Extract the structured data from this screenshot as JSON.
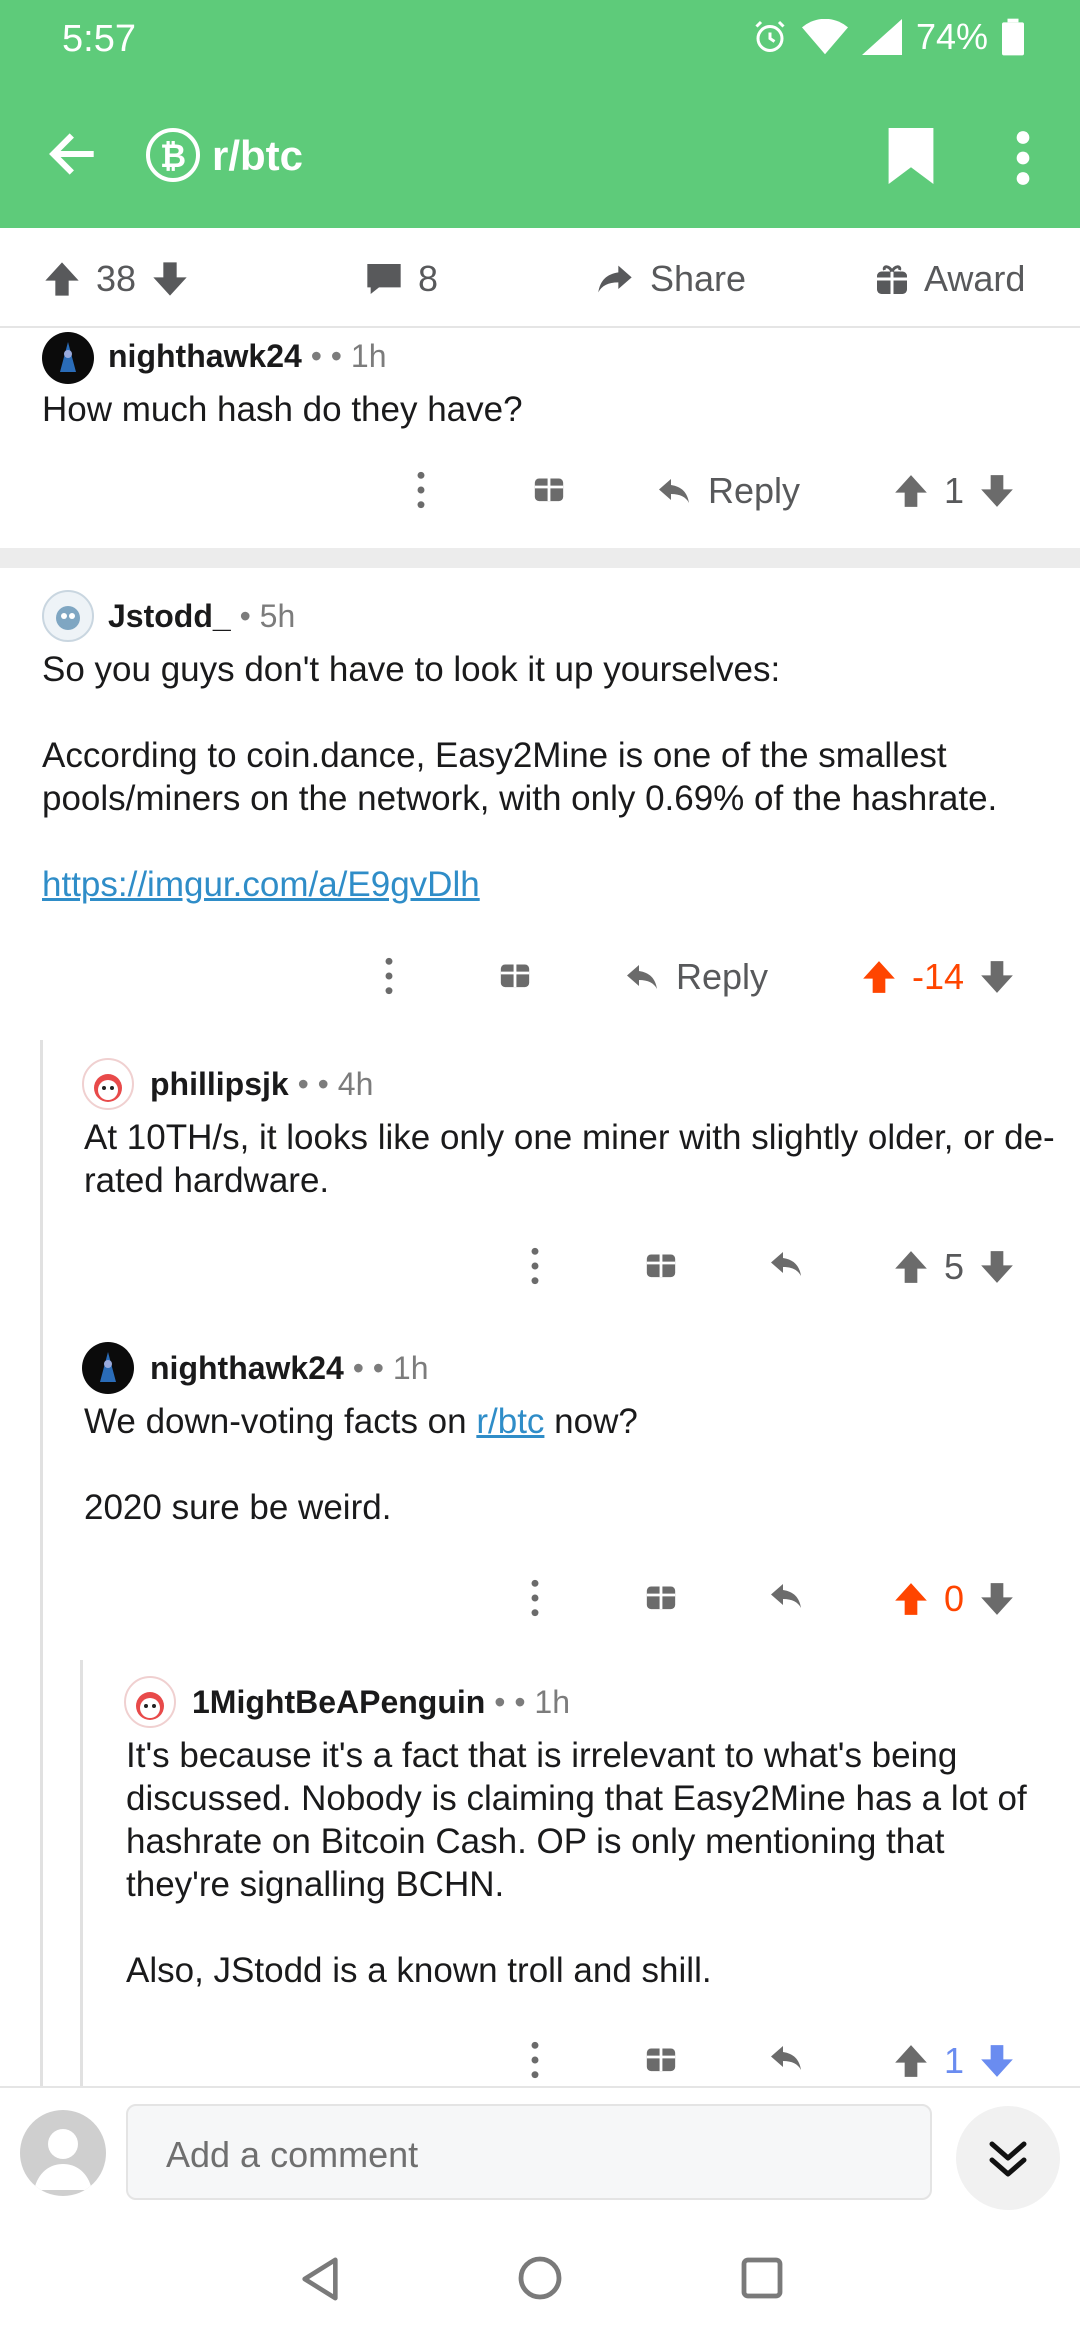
{
  "status": {
    "time": "5:57",
    "battery": "74%"
  },
  "header": {
    "subreddit": "r/btc",
    "sub_glyph": "₿"
  },
  "postbar": {
    "upvotes": "38",
    "comments": "8",
    "share_label": "Share",
    "award_label": "Award"
  },
  "comments": [
    {
      "author": "nighthawk24",
      "separator": "•",
      "age": "• 1h",
      "text": [
        "How much hash do they have?"
      ],
      "reply_label": "Reply",
      "score": "1"
    },
    {
      "author": "Jstodd_",
      "age": "• 5h",
      "text_1": "So you guys don't have to look it up yourselves:",
      "text_2": "According to coin.dance, Easy2Mine is one of the smallest pools/miners on the network, with only 0.69% of the hashrate.",
      "link": "https://imgur.com/a/E9gvDlh",
      "reply_label": "Reply",
      "score": "-14"
    },
    {
      "author": "phillipsjk",
      "separator": "•",
      "age": "• 4h",
      "text": "At 10TH/s, it looks like only one miner with slightly older, or de-rated hardware.",
      "score": "5"
    },
    {
      "author": "nighthawk24",
      "separator": "•",
      "age": "• 1h",
      "text_pre": "We down-voting facts on ",
      "text_link": "r/btc",
      "text_post": " now?",
      "text_2": "2020 sure be weird.",
      "score": "0"
    },
    {
      "author": "1MightBeAPenguin",
      "separator": "•",
      "age": "• 1h",
      "text_1": "It's because it's a fact that is irrelevant to what's being discussed. Nobody is claiming that Easy2Mine has a lot of hashrate on Bitcoin Cash. OP is only mentioning that they're signalling BCHN.",
      "text_2": "Also, JStodd is a known troll and shill.",
      "score": "1"
    }
  ],
  "composer": {
    "placeholder": "Add a comment"
  },
  "colors": {
    "brand": "#5ecb7a",
    "upvote": "#ff4500",
    "downvote": "#6a8cf0",
    "link": "#2f8dc8"
  }
}
